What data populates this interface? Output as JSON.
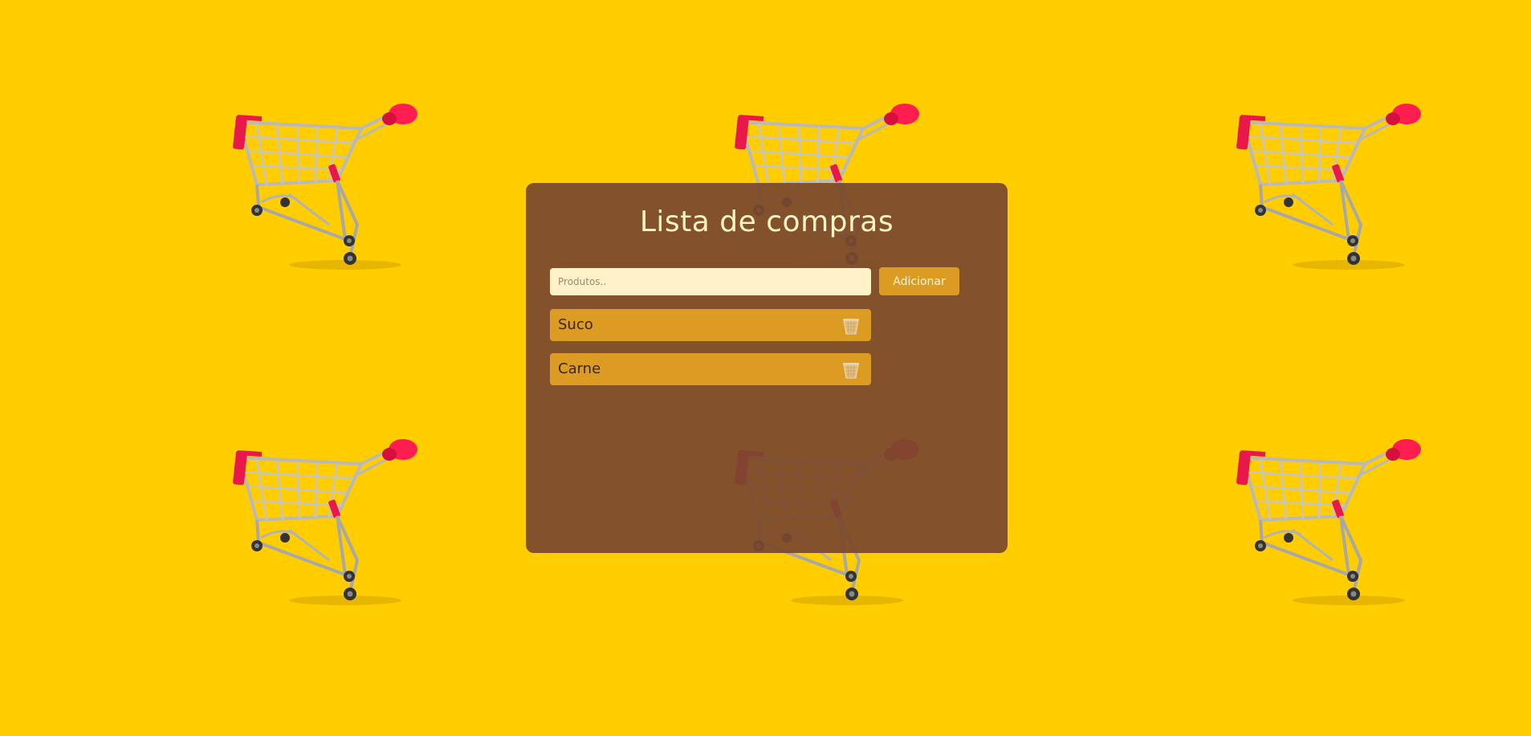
{
  "app": {
    "title": "Lista de compras"
  },
  "form": {
    "input_placeholder": "Produtos..",
    "input_value": "",
    "add_label": "Adicionar"
  },
  "items": [
    {
      "label": "Suco"
    },
    {
      "label": "Carne"
    }
  ],
  "icons": {
    "delete": "trash-icon",
    "background": "shopping-cart-icon"
  },
  "colors": {
    "background": "#ffcd00",
    "panel": "#7a482e",
    "accent": "#dc9b22",
    "input": "#fff2c8",
    "title": "#fff3c4"
  }
}
